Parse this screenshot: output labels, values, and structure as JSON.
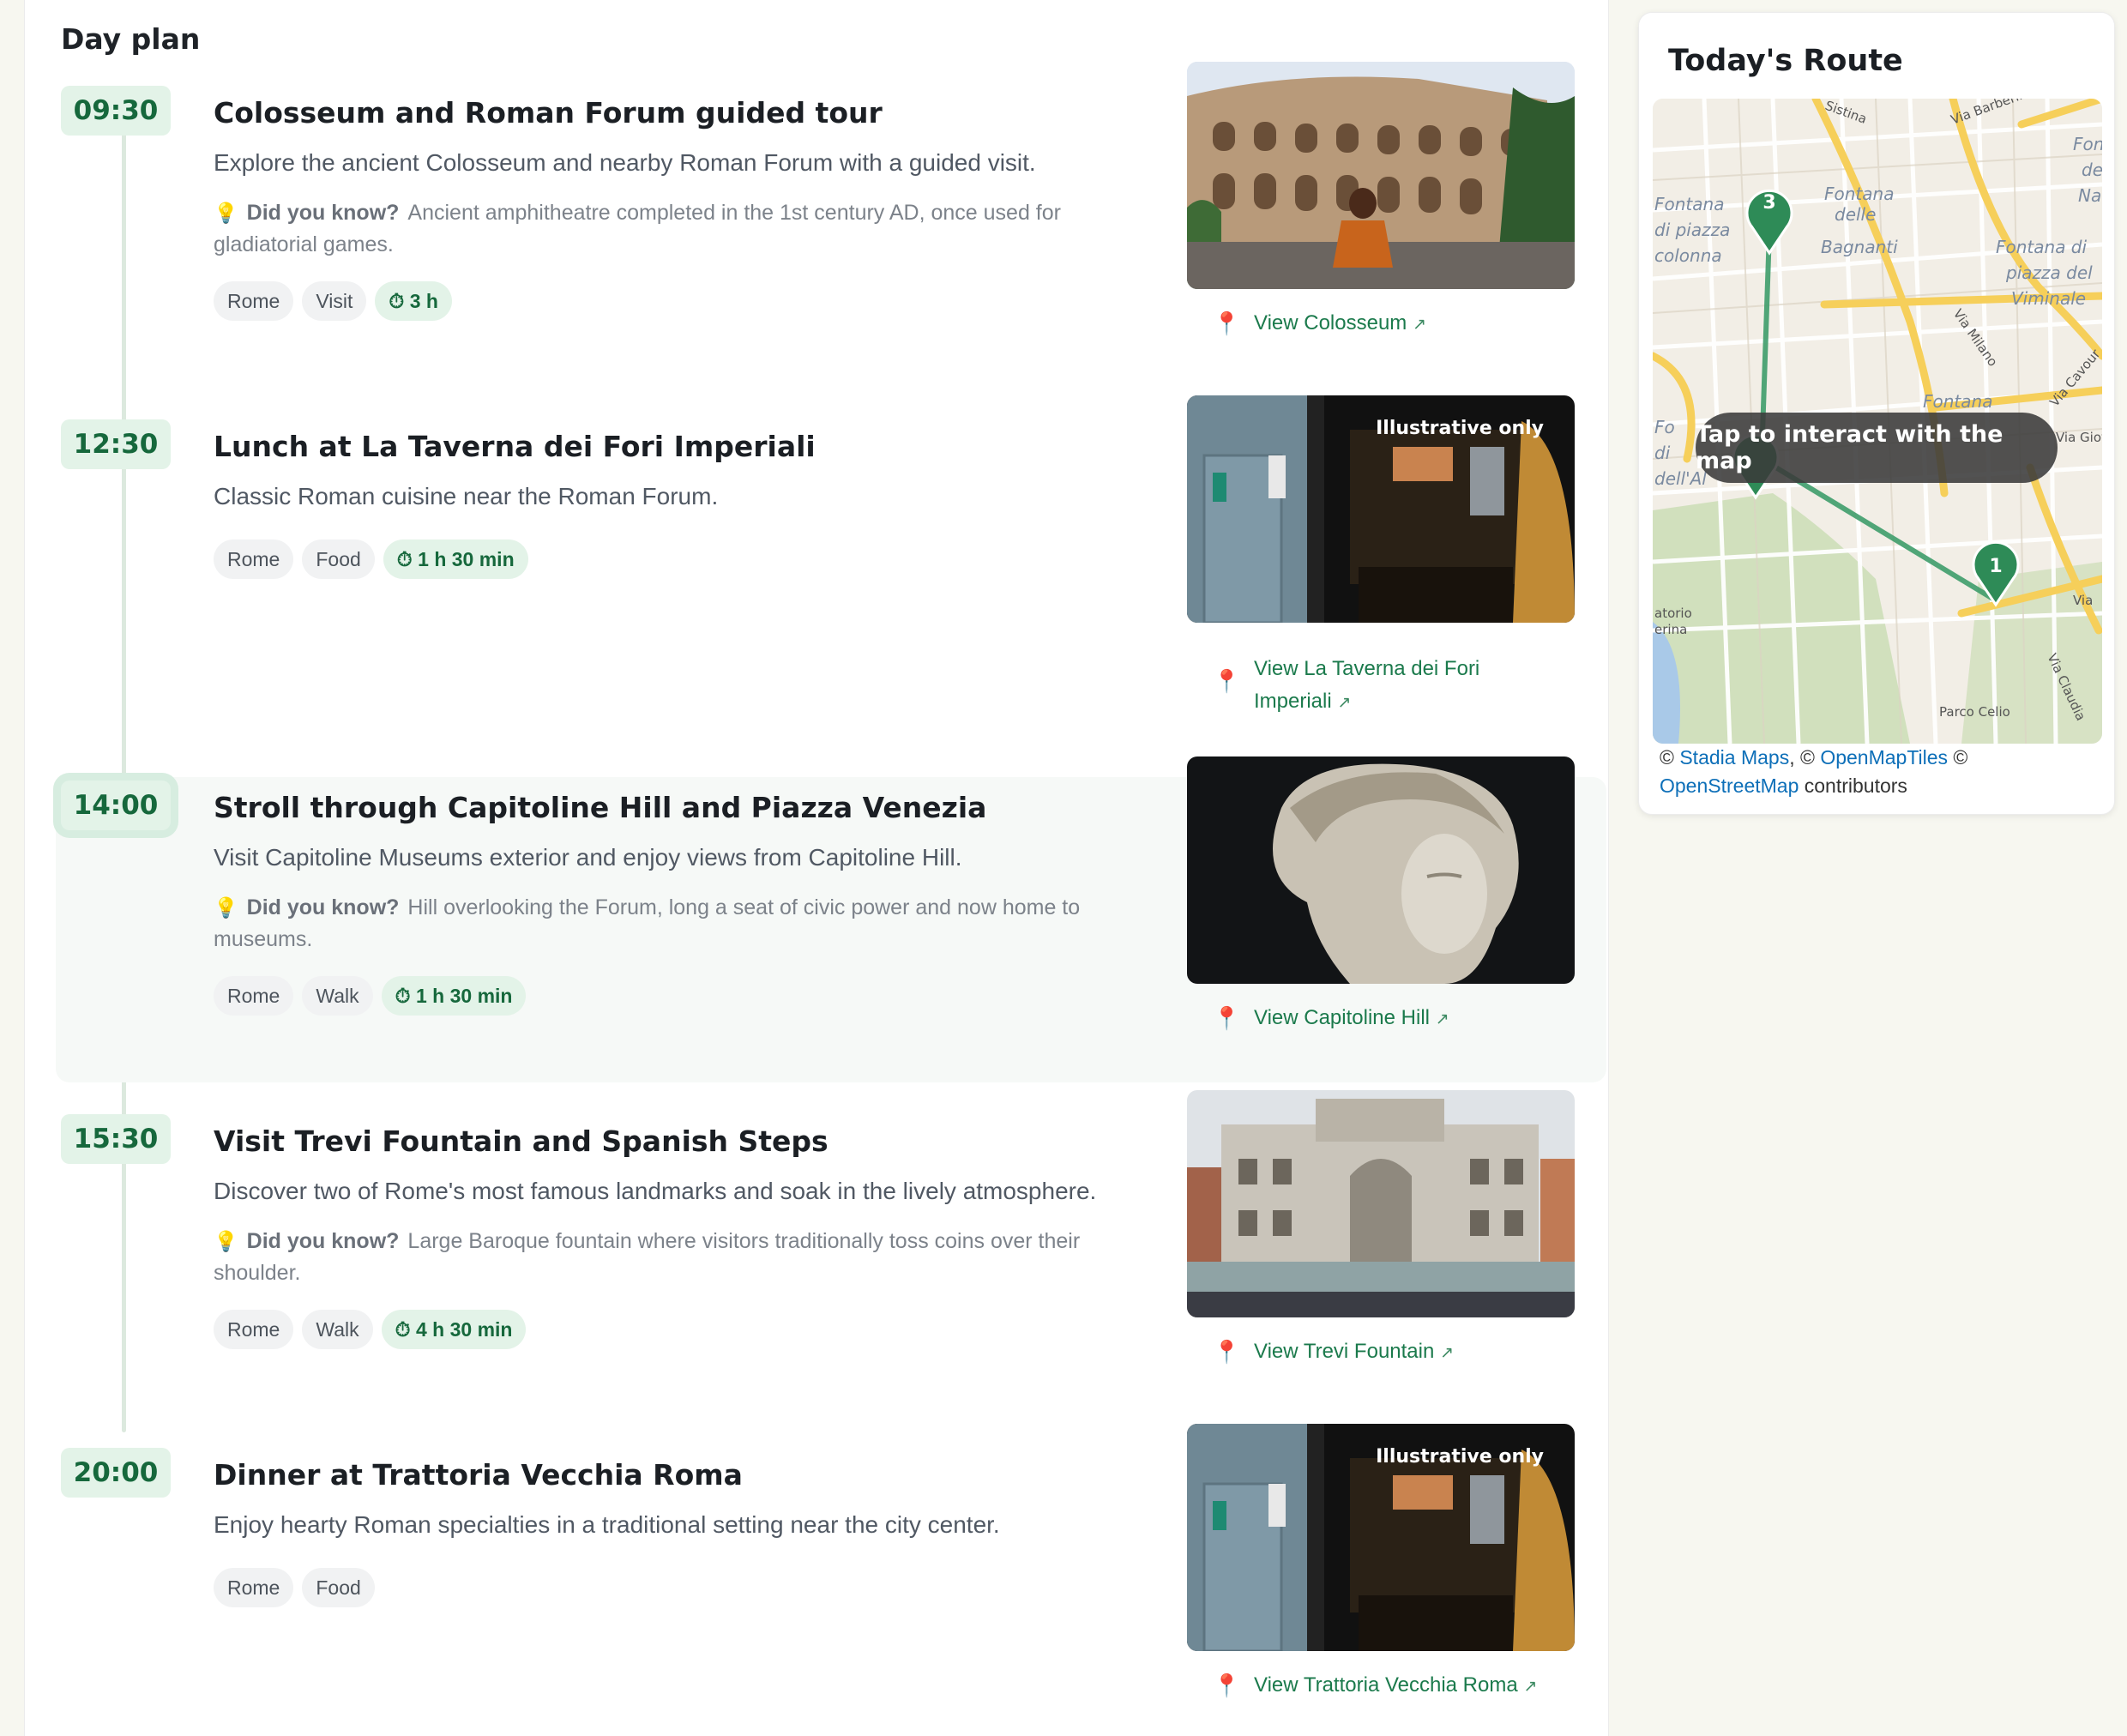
{
  "day_plan": {
    "title": "Day plan",
    "items": [
      {
        "time": "09:30",
        "title": "Colosseum and Roman Forum guided tour",
        "description": "Explore the ancient Colosseum and nearby Roman Forum with a guided visit.",
        "fact_label": "Did you know?",
        "fact": "Ancient amphitheatre completed in the 1st century AD, once used for gladiatorial games.",
        "tags": [
          "Rome",
          "Visit"
        ],
        "duration": "3 h",
        "link": "View Colosseum",
        "image": "colosseum-photo"
      },
      {
        "time": "12:30",
        "title": "Lunch at La Taverna dei Fori Imperiali",
        "description": "Classic Roman cuisine near the Roman Forum.",
        "tags": [
          "Rome",
          "Food"
        ],
        "duration": "1 h 30 min",
        "link_line1": "View La Taverna dei Fori",
        "link_line2": "Imperiali",
        "image_label": "Illustrative only"
      },
      {
        "time": "14:00",
        "title": "Stroll through Capitoline Hill and Piazza Venezia",
        "description": "Visit Capitoline Museums exterior and enjoy views from Capitoline Hill.",
        "fact_label": "Did you know?",
        "fact": "Hill overlooking the Forum, long a seat of civic power and now home to museums.",
        "tags": [
          "Rome",
          "Walk"
        ],
        "duration": "1 h 30 min",
        "link": "View Capitoline Hill"
      },
      {
        "time": "15:30",
        "title": "Visit Trevi Fountain and Spanish Steps",
        "description": "Discover two of Rome's most famous landmarks and soak in the lively atmosphere.",
        "fact_label": "Did you know?",
        "fact": "Large Baroque fountain where visitors traditionally toss coins over their shoulder.",
        "tags": [
          "Rome",
          "Walk"
        ],
        "duration": "4 h 30 min",
        "link": "View Trevi Fountain"
      },
      {
        "time": "20:00",
        "title": "Dinner at Trattoria Vecchia Roma",
        "description": "Enjoy hearty Roman specialties in a traditional setting near the city center.",
        "tags": [
          "Rome",
          "Food"
        ],
        "link": "View Trattoria Vecchia Roma",
        "image_label": "Illustrative only"
      }
    ]
  },
  "route": {
    "title": "Today's Route",
    "tap_label": "Tap to interact with the map",
    "markers": [
      "1",
      "3"
    ],
    "map_labels": {
      "fontana_delle_bagnanti": [
        "Fontana",
        "delle",
        "Bagnanti"
      ],
      "fontana_di_piazza_colonna": [
        "Fontana",
        "di piazza",
        "colonna"
      ],
      "fontana_di_piazza_del_viminale": [
        "Fontana di",
        "piazza del",
        "Viminale"
      ],
      "fontana": "Fontana",
      "via_milano": "Via Milano",
      "via_cavour": "Via Cavour",
      "via_claudia": "Via Claudia",
      "parco_celio": "Parco Celio",
      "via_barberini": "Via Barberini",
      "via_giova": "Via Giova",
      "via": "Via",
      "sistina": "Sistina",
      "atorio_erina": [
        "atorio",
        "erina"
      ],
      "fo_di_dell_al": [
        "Fo",
        "di",
        "dell'Al"
      ],
      "fon_de_nai": [
        "Fon",
        "de",
        "Nai"
      ]
    },
    "attribution": {
      "prefix": "© ",
      "stadia": "Stadia Maps",
      "sep1": ", © ",
      "omt": "OpenMapTiles",
      "sep2": " ©",
      "osm": "OpenStreetMap",
      "suffix": " contributors"
    }
  },
  "colors": {
    "accent": "#16683c",
    "badge_bg": "#e3f3e8",
    "pin": "#e2356f",
    "marker": "#2e8b57"
  }
}
